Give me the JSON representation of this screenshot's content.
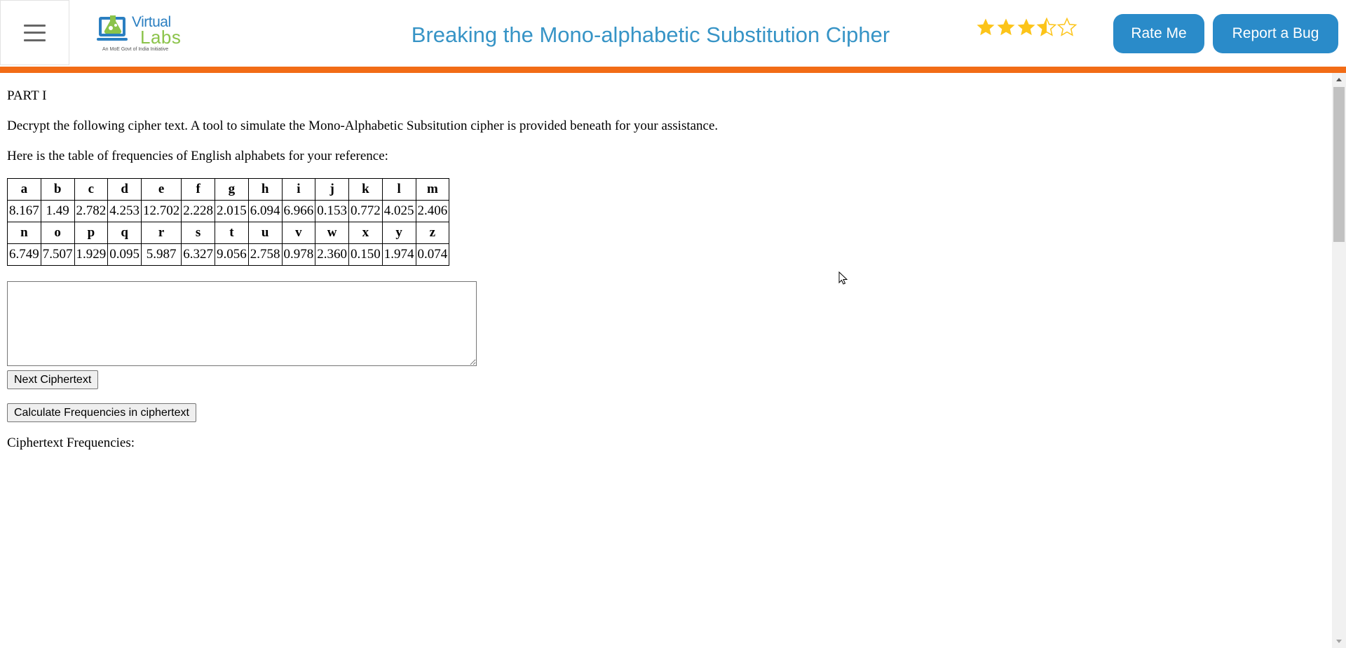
{
  "header": {
    "menu_icon": "hamburger-menu-icon",
    "logo": {
      "word1": "Virtual",
      "word2": "Labs",
      "tagline": "An MoE Govt of India Initiative"
    },
    "title": "Breaking the Mono-alphabetic Substitution Cipher",
    "rating": {
      "value": 3.5,
      "max": 5,
      "star_color": "#fcc419"
    },
    "rate_button": "Rate Me",
    "bug_button": "Report a Bug",
    "accent_color": "#2a8bc9",
    "bar_color": "#f26c16"
  },
  "content": {
    "part_heading": "PART I",
    "instruction": "Decrypt the following cipher text. A tool to simulate the Mono-Alphabetic Subsitution cipher is provided beneath for your assistance.",
    "table_intro": "Here is the table of frequencies of English alphabets for your reference:",
    "freq_table": {
      "row1_letters": [
        "a",
        "b",
        "c",
        "d",
        "e",
        "f",
        "g",
        "h",
        "i",
        "j",
        "k",
        "l",
        "m"
      ],
      "row1_values": [
        "8.167",
        "1.49",
        "2.782",
        "4.253",
        "12.702",
        "2.228",
        "2.015",
        "6.094",
        "6.966",
        "0.153",
        "0.772",
        "4.025",
        "2.406"
      ],
      "row2_letters": [
        "n",
        "o",
        "p",
        "q",
        "r",
        "s",
        "t",
        "u",
        "v",
        "w",
        "x",
        "y",
        "z"
      ],
      "row2_values": [
        "6.749",
        "7.507",
        "1.929",
        "0.095",
        "5.987",
        "6.327",
        "9.056",
        "2.758",
        "0.978",
        "2.360",
        "0.150",
        "1.974",
        "0.074"
      ]
    },
    "ciphertext_value": "",
    "next_button": "Next Ciphertext",
    "calc_button": "Calculate Frequencies in ciphertext",
    "ciphertext_freq_label": "Ciphertext Frequencies:"
  }
}
